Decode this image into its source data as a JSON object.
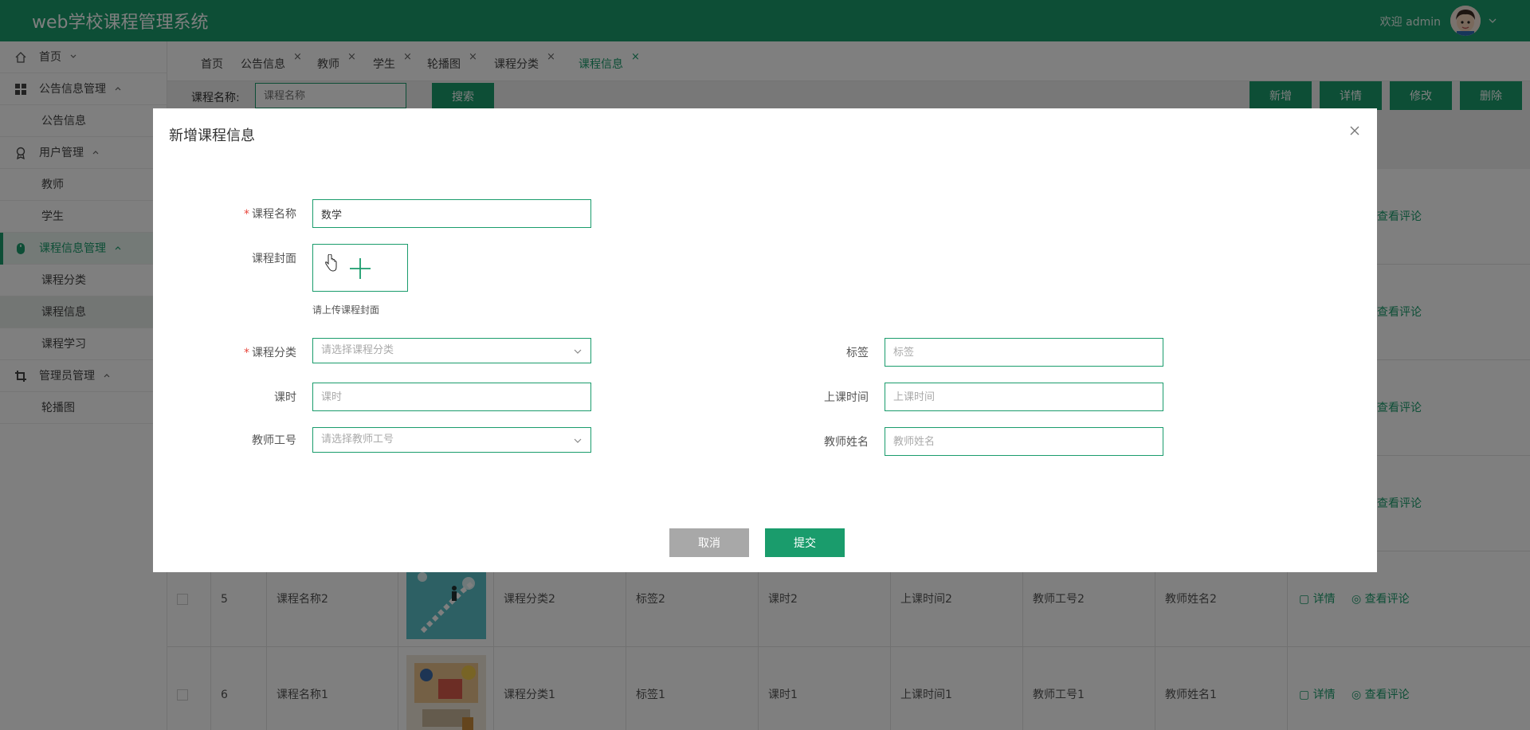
{
  "header": {
    "title": "web学校课程管理系统",
    "welcome": "欢迎 admin"
  },
  "sidebar": {
    "home": "首页",
    "notice_group": "公告信息管理",
    "notice": "公告信息",
    "user_group": "用户管理",
    "teacher": "教师",
    "student": "学生",
    "course_group": "课程信息管理",
    "course_category": "课程分类",
    "course_info": "课程信息",
    "course_study": "课程学习",
    "admin_group": "管理员管理",
    "carousel": "轮播图"
  },
  "tabs": [
    "首页",
    "公告信息",
    "教师",
    "学生",
    "轮播图",
    "课程分类",
    "课程信息"
  ],
  "toolbar": {
    "search_label": "课程名称:",
    "search_placeholder": "课程名称",
    "search_btn": "搜索",
    "add_btn": "新增",
    "detail_btn": "详情",
    "edit_btn": "修改",
    "delete_btn": "删除"
  },
  "table": {
    "actions": {
      "detail": "详情",
      "comments": "查看评论",
      "comments_partial": "查看评论"
    },
    "rows": [
      {
        "id": "5",
        "name": "课程名称2",
        "category": "课程分类2",
        "tag": "标签2",
        "hours": "课时2",
        "time": "上课时间2",
        "teacher_no": "教师工号2",
        "teacher_name": "教师姓名2"
      },
      {
        "id": "6",
        "name": "课程名称1",
        "category": "课程分类1",
        "tag": "标签1",
        "hours": "课时1",
        "time": "上课时间1",
        "teacher_no": "教师工号1",
        "teacher_name": "教师姓名1"
      }
    ]
  },
  "modal": {
    "title": "新增课程信息",
    "course_name_label": "课程名称",
    "course_name_value": "数学",
    "cover_label": "课程封面",
    "cover_hint": "请上传课程封面",
    "category_label": "课程分类",
    "category_placeholder": "请选择课程分类",
    "tag_label": "标签",
    "tag_placeholder": "标签",
    "hours_label": "课时",
    "hours_placeholder": "课时",
    "time_label": "上课时间",
    "time_placeholder": "上课时间",
    "teacher_no_label": "教师工号",
    "teacher_no_placeholder": "请选择教师工号",
    "teacher_name_label": "教师姓名",
    "teacher_name_placeholder": "教师姓名",
    "cancel_btn": "取消",
    "submit_btn": "提交"
  },
  "colors": {
    "primary": "#1a9c6c",
    "cancel": "#a8a8a8",
    "required": "#e8463c"
  }
}
